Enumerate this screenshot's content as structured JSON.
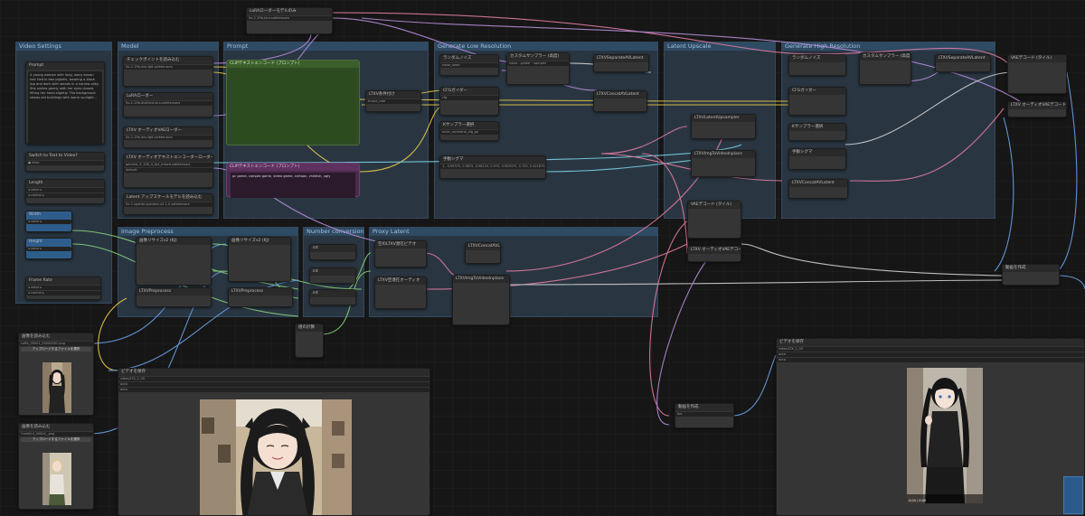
{
  "groups": {
    "video_settings": "Video Settings",
    "model": "Model",
    "prompt": "Prompt",
    "generate_low": "Generate Low Resolution",
    "latent_upscale": "Latent Upscale",
    "generate_high": "Generate High Resolution",
    "image_preprocess": "Image Preprocess",
    "number_conversion": "Number conversion",
    "proxy_latent": "Proxy Latent"
  },
  "nodes": {
    "prompt_label": "Prompt",
    "prompt_text": "A young woman with long, wavy brown hair tied in two pigtails, wearing a black top and dark skirt stands in a narrow alley. She smiles gently with her eyes closed, tilting her head slightly. The background shows old buildings with warm sunlight...",
    "switch_t2v": "Switch to Text to Video?",
    "length": "Length",
    "width": "Width",
    "height": "Height",
    "frame_rate": "Frame Rate",
    "load_checkpoint": "チェックポイントを読み込む",
    "ltxv_model": "ltx-2-19b-dev-fp8.safetensors",
    "lora_loader": "LoRAローダー",
    "clip_loader": "LTXV オーディオテキストエンコーダーローダー",
    "gemma": "gemma_3_12B_it_fp4_mixed.safetensors",
    "latent_upscale_model": "Latent アップスケールモデルを読み込む",
    "upscaler": "ltx-2-spatial-upscaler-x2-1.0.safetensors",
    "clip_text_pos": "CLIPテキストエンコード (プロンプト)",
    "clip_text_neg": "CLIPテキストエンコード (プロンプト)",
    "neg_text": "pc game, console game, video game, cartoon, childish, ugly",
    "ltxv_conditioning": "LTXV条件付け",
    "random_noise": "ランダムノイズ",
    "ksampler_select": "Kサンプラー選択",
    "sampler_custom": "カスタムサンプラー (高度)",
    "sigmas": "手動シグマ",
    "sigma_values": "1., 0.99375, 0.9875, 0.98125, 0.975, 0.909375, 0.725, 0.421875, 0.0",
    "cfg_guider": "CFGガイダー",
    "ltxv_separate": "LTXVSeparateAVLatent",
    "ltxv_concat": "LTXVConcatAVLatent",
    "ltxv_latent_upsampler": "LTXVLatentUpsampler",
    "ltxv_img_inplace": "LTXVImgToVideoInplace",
    "vae_decode": "VAEデコード (タイル)",
    "ltxv_audio_vae": "LTXV オーディオVAEデコード",
    "create_video": "動画を作成",
    "save_video": "ビデオを保存",
    "load_image": "画像を読み込む",
    "file1": "LoRA_00001_00000001.png",
    "file2": "ComfyUI_00004_.png",
    "upload_label": "アップロードするファイルを選択",
    "resize_image": "画像リサイズv2 (KJ)",
    "ltxv_preprocess": "LTXVPreprocess",
    "empty_latent": "空のLTXV潜在ビデオ",
    "empty_audio": "LTXV空潜在オーディオ",
    "proxy_value": "値の計算",
    "video_preview": "ビデオを保存",
    "filename": "video/LTX_2_00",
    "time_start": "0:00 / 0:05"
  },
  "colors": {
    "wire_yellow": "#e6c84a",
    "wire_purple": "#b58cd9",
    "wire_pink": "#e07aa0",
    "wire_cyan": "#7ad0e0",
    "wire_green": "#8ad07a",
    "wire_blue": "#6aa0e6",
    "wire_orange": "#e0a050",
    "wire_white": "#d0d0d0"
  }
}
